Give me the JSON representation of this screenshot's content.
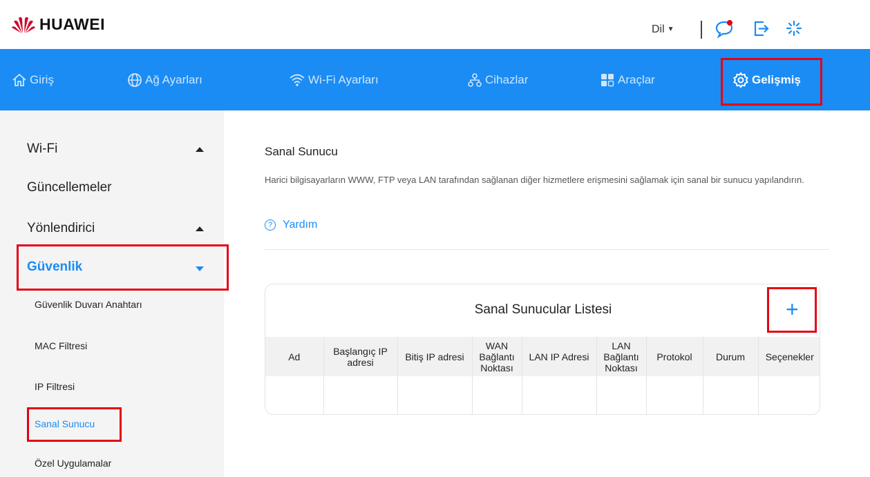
{
  "header": {
    "brand": "HUAWEI",
    "language_label": "Dil",
    "icons": [
      "notification-icon",
      "logout-icon",
      "loading-icon"
    ]
  },
  "nav": {
    "items": [
      {
        "label": "Giriş",
        "icon": "home-icon"
      },
      {
        "label": "Ağ Ayarları",
        "icon": "globe-icon"
      },
      {
        "label": "Wi-Fi Ayarları",
        "icon": "wifi-icon"
      },
      {
        "label": "Cihazlar",
        "icon": "devices-icon"
      },
      {
        "label": "Araçlar",
        "icon": "tools-icon"
      },
      {
        "label": "Gelişmiş",
        "icon": "gear-icon",
        "active": true
      }
    ]
  },
  "sidebar": {
    "sections": [
      {
        "label": "Wi-Fi",
        "arrow": "up"
      },
      {
        "label": "Güncellemeler"
      },
      {
        "label": "Yönlendirici",
        "arrow": "up"
      },
      {
        "label": "Güvenlik",
        "arrow": "down",
        "active": true
      }
    ],
    "sub_items": [
      {
        "label": "Güvenlik Duvarı Anahtarı"
      },
      {
        "label": "MAC Filtresi"
      },
      {
        "label": "IP Filtresi"
      },
      {
        "label": "Sanal Sunucu",
        "active": true
      },
      {
        "label": "Özel Uygulamalar"
      }
    ]
  },
  "main": {
    "title": "Sanal Sunucu",
    "description": "Harici bilgisayarların WWW, FTP veya LAN tarafından sağlanan diğer hizmetlere erişmesini sağlamak için sanal bir sunucu yapılandırın.",
    "help_label": "Yardım",
    "card": {
      "title": "Sanal Sunucular Listesi",
      "add_symbol": "+",
      "columns": [
        "Ad",
        "Başlangıç IP adresi",
        "Bitiş IP adresi",
        "WAN Bağlantı Noktası",
        "LAN IP Adresi",
        "LAN Bağlantı Noktası",
        "Protokol",
        "Durum",
        "Seçenekler"
      ],
      "rows": []
    }
  },
  "colors": {
    "nav_bg": "#1a8cf4",
    "accent": "#1a8cf4",
    "highlight_box": "#e60012",
    "sidebar_bg": "#f4f4f4"
  }
}
